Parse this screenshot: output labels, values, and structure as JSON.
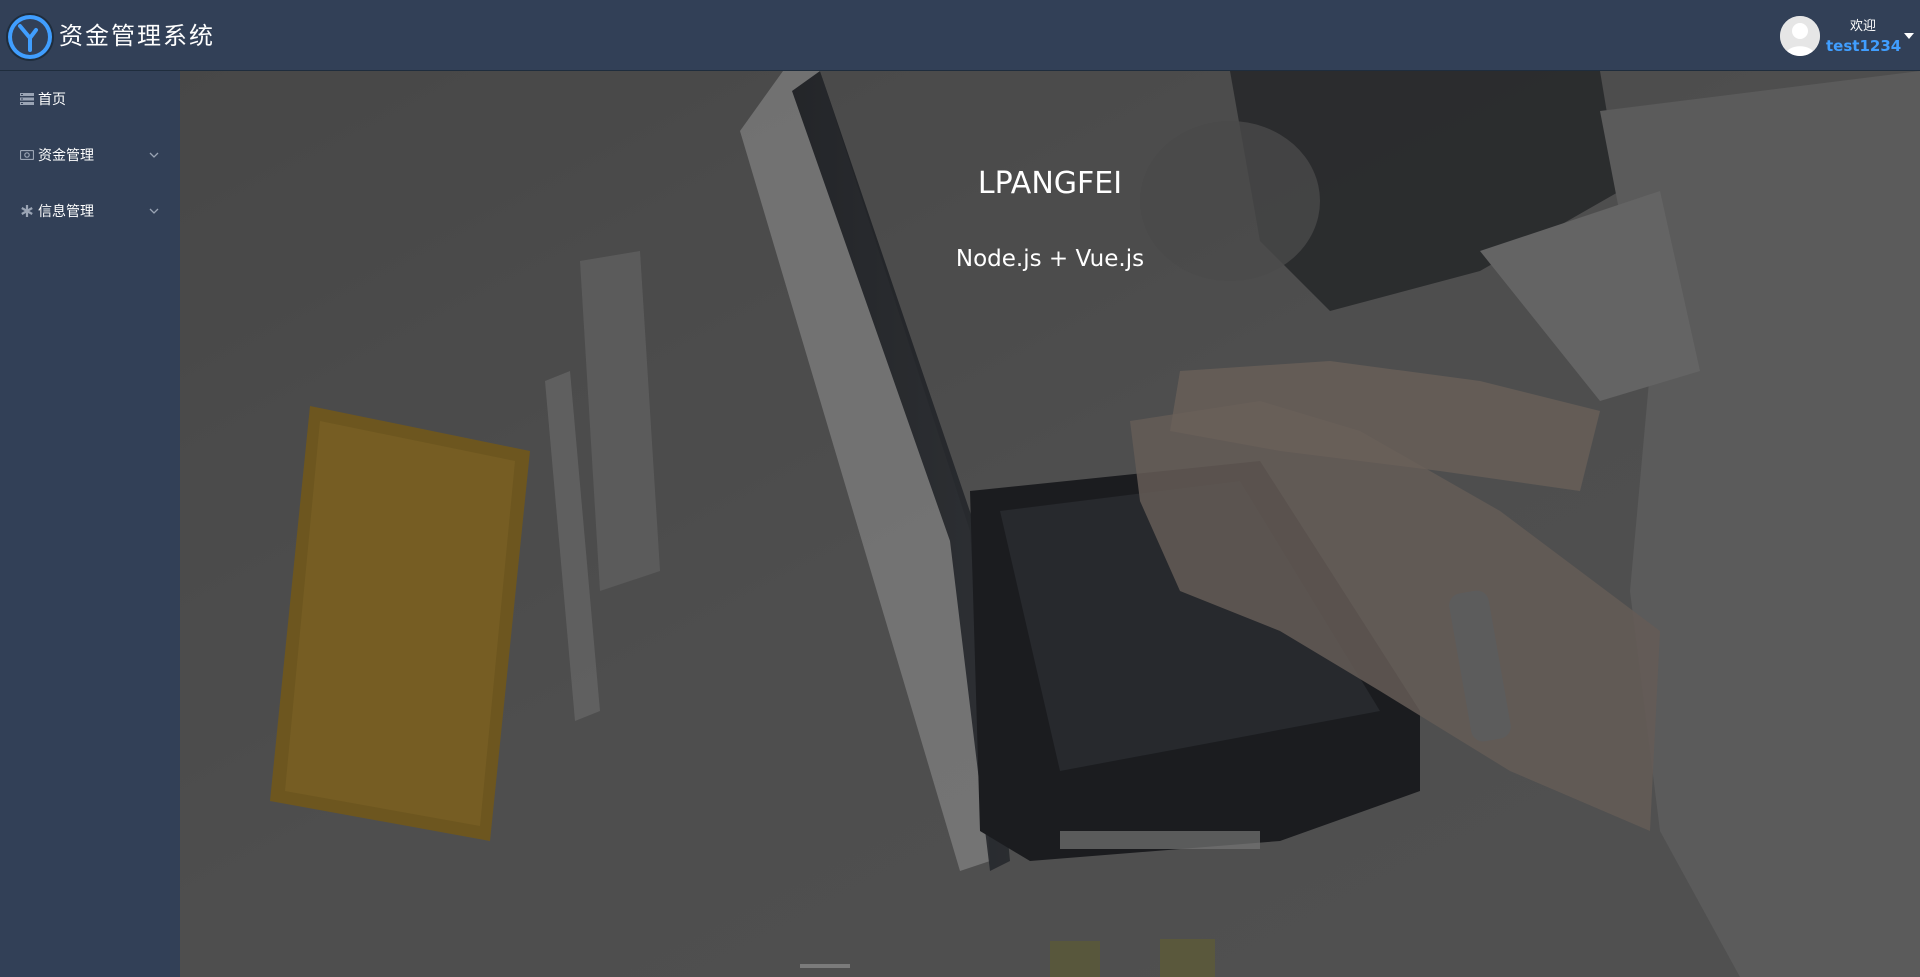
{
  "header": {
    "app_title": "资金管理系统",
    "logo_icon": "clock-logo-icon",
    "user": {
      "welcome_label": "欢迎",
      "username": "test1234",
      "avatar_icon": "user-avatar-icon",
      "dropdown_icon": "caret-down-icon"
    }
  },
  "sidebar": {
    "items": [
      {
        "label": "首页",
        "icon": "list-icon",
        "has_submenu": false
      },
      {
        "label": "资金管理",
        "icon": "money-icon",
        "has_submenu": true
      },
      {
        "label": "信息管理",
        "icon": "asterisk-icon",
        "has_submenu": true
      }
    ]
  },
  "main": {
    "hero_title": "LPANGFEI",
    "hero_subtitle": "Node.js + Vue.js"
  },
  "colors": {
    "header_bg": "#324057",
    "sidebar_bg": "#324057",
    "username": "#409eff",
    "text": "#ffffff"
  }
}
